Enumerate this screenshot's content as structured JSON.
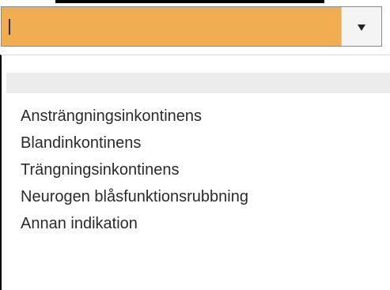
{
  "select": {
    "value": "",
    "dropdown_icon": "triangle-down-icon"
  },
  "options": [
    "Ansträngningsinkontinens",
    "Blandinkontinens",
    "Trängningsinkontinens",
    "Neurogen blåsfunktionsrubbning",
    "Annan indikation"
  ],
  "colors": {
    "selected_field": "#f0ad52",
    "blank_option_row": "#ececec",
    "text": "#2a2a2a"
  }
}
